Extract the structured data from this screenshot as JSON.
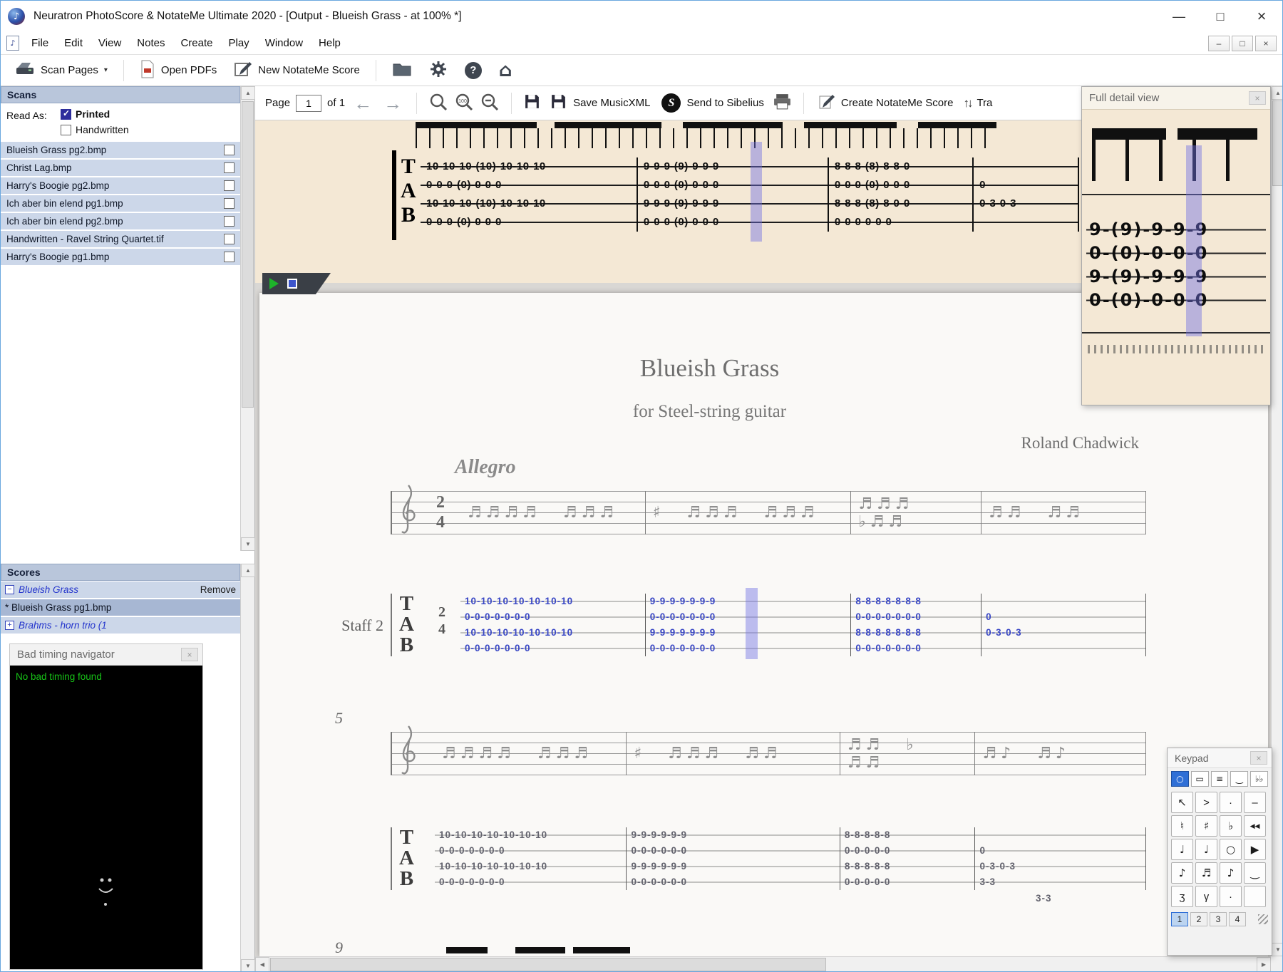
{
  "window": {
    "title": "Neuratron PhotoScore & NotateMe Ultimate 2020 - [Output - Blueish Grass - at 100% *]",
    "minimize": "—",
    "maximize": "□",
    "close": "×"
  },
  "icons": {
    "caret": "▾",
    "close": "×",
    "up": "▲",
    "down": "▼",
    "left": "◀",
    "right": "▶",
    "back": "←",
    "forward": "→",
    "help": "?",
    "home": "⌂",
    "transpose": "↑↓",
    "note": "♪",
    "mdi_minimize": "–",
    "mdi_restore": "□",
    "mdi_close": "×",
    "collapse": "−",
    "expand": "+"
  },
  "menubar": {
    "items": [
      "File",
      "Edit",
      "View",
      "Notes",
      "Create",
      "Play",
      "Window",
      "Help"
    ]
  },
  "toolbar": {
    "scan_pages": "Scan Pages",
    "open_pdfs": "Open PDFs",
    "new_notateme": "New NotateMe Score"
  },
  "scans_panel": {
    "title": "Scans",
    "read_as": "Read As:",
    "printed": "Printed",
    "handwritten": "Handwritten",
    "items": [
      "Blueish Grass pg2.bmp",
      "Christ Lag.bmp",
      "Harry's Boogie pg2.bmp",
      "Ich aber bin elend pg1.bmp",
      "Ich aber bin elend pg2.bmp",
      "Handwritten - Ravel String Quartet.tif",
      "Harry's Boogie pg1.bmp"
    ]
  },
  "scores_panel": {
    "title": "Scores",
    "score_name": "Blueish Grass",
    "remove": "Remove",
    "page_item": "* Blueish Grass pg1.bmp",
    "other_score": "Brahms - horn trio (1"
  },
  "bad_timing": {
    "title": "Bad timing navigator",
    "message": "No bad timing found"
  },
  "page_toolbar": {
    "page_label": "Page",
    "page_value": "1",
    "of_label": "of 1",
    "zoom_value": "100",
    "save_musicxml": "Save MusicXML",
    "send_to_sibelius": "Send to Sibelius",
    "create_notateme": "Create NotateMe Score",
    "transpose_label": "Tra"
  },
  "scan_view": {
    "rows": [
      [
        "10-10-10-(10)-10-10-10",
        "9-9-9-(9)-9-9-9",
        "8-8-8-(8)-8-8-0",
        ""
      ],
      [
        "0-0-0-(0)-0-0-0",
        "0-0-0-(0)-0-0-0",
        "0-0-0-(0)-0-0-0",
        "0"
      ],
      [
        "10-10-10-(10)-10-10-10",
        "9-9-9-(9)-9-9-9",
        "8-8-8-(8)-8-0-0",
        "0-3-0-3"
      ],
      [
        "0-0-0-(0)-0-0-0",
        "0-0-0-(0)-0-0-0",
        "0-0-0-0-0-0",
        ""
      ]
    ]
  },
  "score": {
    "title": "Blueish Grass",
    "subtitle": "for Steel-string guitar",
    "composer": "Roland Chadwick",
    "tempo": "Allegro",
    "staff_label": "Staff 2",
    "tab_clef": [
      "T",
      "A",
      "B"
    ],
    "time_top": "2",
    "time_bottom": "4",
    "measure_5": "5",
    "measure_9": "9",
    "extra": "3-3",
    "system1": {
      "note_rows": [
        [
          "♬♬♬♬ ♬♬♬",
          "♯ ♬♬♬ ♬♬♬",
          "♬♬♬ ♭♬♬",
          "♬♬ ♬♬"
        ]
      ],
      "tab_rows": [
        [
          "10-10-10-10-10-10-10",
          "9-9-9-9-9-9-9",
          "8-8-8-8-8-8-8",
          ""
        ],
        [
          "0-0-0-0-0-0-0",
          "0-0-0-0-0-0-0",
          "0-0-0-0-0-0-0",
          "0"
        ],
        [
          "10-10-10-10-10-10-10",
          "9-9-9-9-9-9-9",
          "8-8-8-8-8-8-8",
          "0-3-0-3"
        ],
        [
          "0-0-0-0-0-0-0",
          "0-0-0-0-0-0-0",
          "0-0-0-0-0-0-0",
          ""
        ]
      ]
    },
    "system2": {
      "note_rows": [
        [
          "♬♬♬♬ ♬♬♬",
          "♯ ♬♬♬ ♬♬",
          "♬♬ ♭ ♬♬",
          "♬♪ ♬♪"
        ]
      ],
      "tab_rows": [
        [
          "10-10-10-10-10-10-10",
          "9-9-9-9-9-9",
          "8-8-8-8-8",
          ""
        ],
        [
          "0-0-0-0-0-0-0",
          "0-0-0-0-0-0",
          "0-0-0-0-0",
          "0"
        ],
        [
          "10-10-10-10-10-10-10",
          "9-9-9-9-9-9",
          "8-8-8-8-8",
          "0-3-0-3"
        ],
        [
          "0-0-0-0-0-0-0",
          "0-0-0-0-0-0",
          "0-0-0-0-0",
          "3-3"
        ]
      ]
    }
  },
  "full_detail": {
    "title": "Full detail view",
    "rows": [
      "9-(9)-9-9-9",
      "0-(0)-0-0-0",
      "9-(9)-9-9-9",
      "0-(0)-0-0-0"
    ]
  },
  "keypad": {
    "title": "Keypad",
    "toggles": [
      "○",
      "▭",
      "≡",
      "‿",
      "♭♭"
    ],
    "grid": [
      [
        "↖",
        ">",
        "·",
        "–"
      ],
      [
        "♮",
        "♯",
        "♭",
        "◀◀"
      ],
      [
        "♩",
        "♩",
        "○",
        "▶"
      ],
      [
        "♪",
        "♬",
        "♪",
        "‿"
      ],
      [
        "ʒ",
        "γ",
        "·",
        ""
      ]
    ],
    "tabs": [
      "1",
      "2",
      "3",
      "4"
    ]
  }
}
